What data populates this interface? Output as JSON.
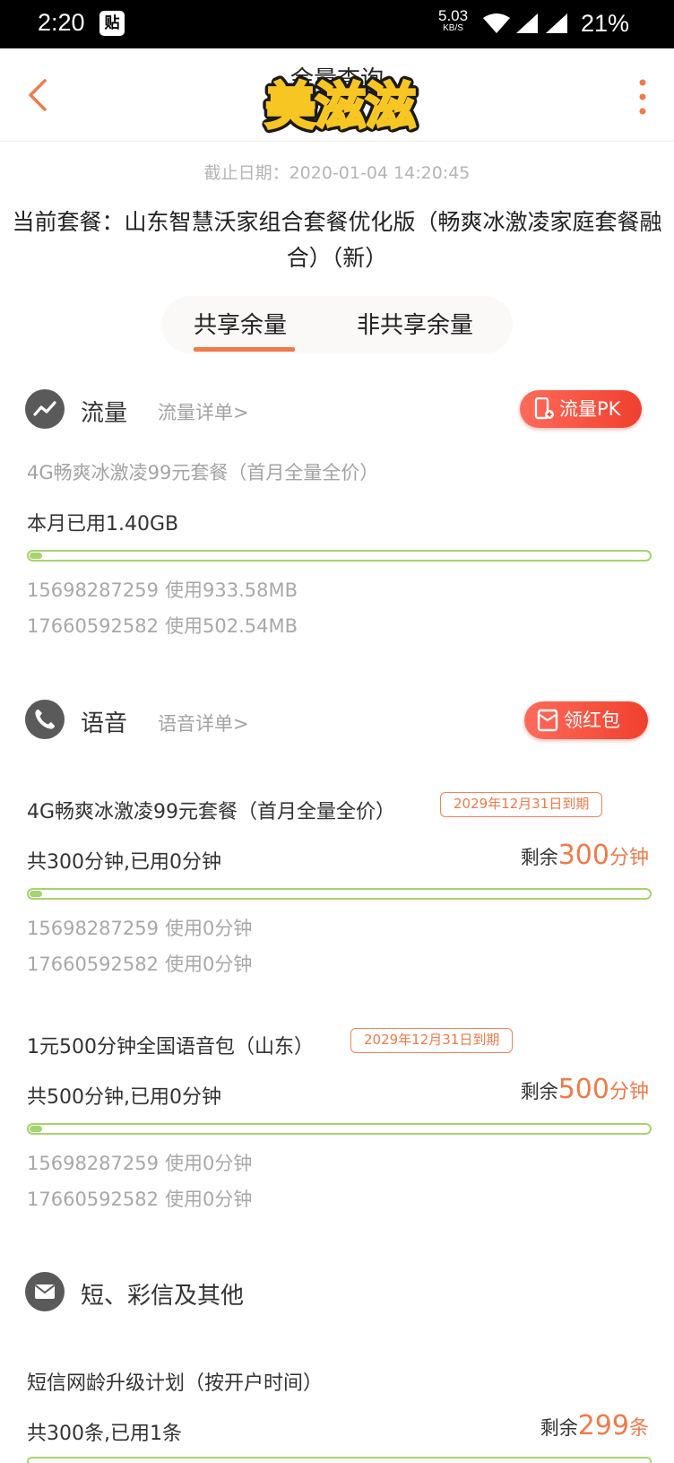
{
  "status_bar": {
    "time": "2:20",
    "notif_glyph": "贴",
    "net_speed": "5.03",
    "net_speed_unit": "KB/S",
    "battery": "21%"
  },
  "header": {
    "title": "余量查询",
    "logo_text": "美滋滋"
  },
  "deadline": "截止日期：2020-01-04 14:20:45",
  "plan_name": "当前套餐：山东智慧沃家组合套餐优化版（畅爽冰激凌家庭套餐融合）（新）",
  "tabs": [
    {
      "label": "共享余量",
      "active": true
    },
    {
      "label": "非共享余量",
      "active": false
    }
  ],
  "data_section": {
    "title": "流量",
    "link": "流量详单>",
    "pill": "流量PK",
    "package": "4G畅爽冰激凌99元套餐（首月全量全价）",
    "usage": "本月已用1.40GB",
    "progress": 0.02,
    "lines": [
      {
        "number": "15698287259",
        "used": "使用933.58MB"
      },
      {
        "number": "17660592582",
        "used": "使用502.54MB"
      }
    ]
  },
  "voice_section": {
    "title": "语音",
    "link": "语音详单>",
    "pill": "领红包",
    "packages": [
      {
        "name": "4G畅爽冰激凌99元套餐（首月全量全价）",
        "expiry": "2029年12月31日到期",
        "usage": "共300分钟,已用0分钟",
        "remain_label": "剩余",
        "remain_value": "300",
        "remain_unit": "分钟",
        "progress": 0.02,
        "lines": [
          {
            "number": "15698287259",
            "used": "使用0分钟"
          },
          {
            "number": "17660592582",
            "used": "使用0分钟"
          }
        ]
      },
      {
        "name": "1元500分钟全国语音包（山东）",
        "expiry": "2029年12月31日到期",
        "usage": "共500分钟,已用0分钟",
        "remain_label": "剩余",
        "remain_value": "500",
        "remain_unit": "分钟",
        "progress": 0.02,
        "lines": [
          {
            "number": "15698287259",
            "used": "使用0分钟"
          },
          {
            "number": "17660592582",
            "used": "使用0分钟"
          }
        ]
      }
    ]
  },
  "sms_section": {
    "title": "短、彩信及其他",
    "package": "短信网龄升级计划（按开户时间）",
    "usage": "共300条,已用1条",
    "remain_label": "剩余",
    "remain_value": "299",
    "remain_unit": "条"
  },
  "colors": {
    "accent": "#f07a4a",
    "progress": "#a6d46e",
    "pill": "#f0402e",
    "icon_bg": "#5a5a5a"
  }
}
